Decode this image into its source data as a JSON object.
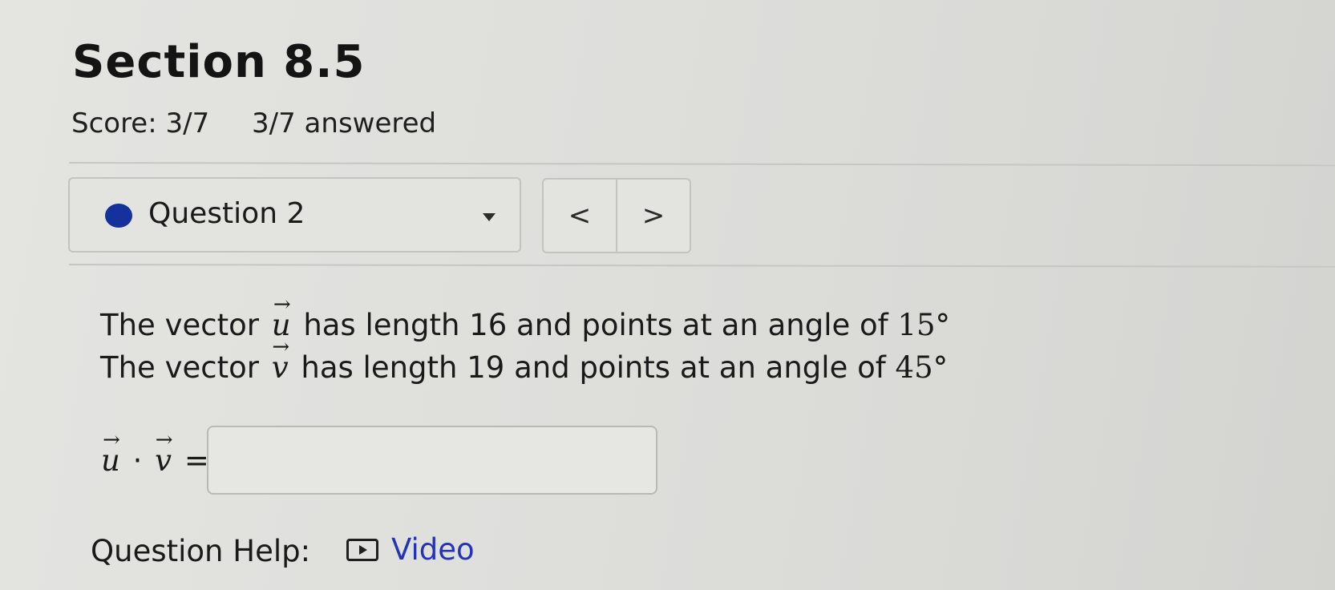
{
  "section_title": "Section 8.5",
  "score": {
    "score_text": "Score: 3/7",
    "answered_text": "3/7 answered"
  },
  "question_selector": {
    "label": "Question 2",
    "status_color": "#15319c"
  },
  "nav": {
    "prev": "<",
    "next": ">"
  },
  "problem": {
    "line1_prefix": "The vector",
    "line1_var": "u",
    "line1_mid": "has length 16 and points at an angle of",
    "line1_angle": "15°",
    "line2_prefix": "The vector",
    "line2_var": "v",
    "line2_mid": "has length 19 and points at an angle of",
    "line2_angle": "45°"
  },
  "answer": {
    "var1": "u",
    "operator": "·",
    "var2": "v",
    "equals": "=",
    "value": ""
  },
  "help": {
    "label": "Question Help:",
    "video_label": "Video",
    "link_color": "#2433b8"
  }
}
